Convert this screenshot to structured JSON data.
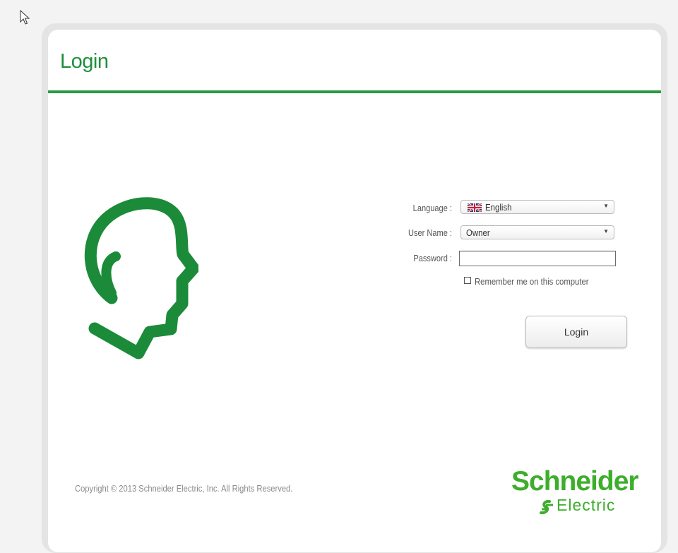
{
  "page": {
    "title": "Login"
  },
  "form": {
    "language_label": "Language :",
    "language_value": "English",
    "username_label": "User Name :",
    "username_value": "Owner",
    "password_label": "Password :",
    "password_value": "",
    "remember_label": "Remember me on this computer",
    "remember_checked": false,
    "login_button_label": "Login"
  },
  "footer": {
    "copyright": "Copyright © 2013 Schneider Electric, Inc. All Rights Reserved."
  },
  "brand": {
    "wordmark": "Schneider Electric",
    "wordmark_top": "Schneider",
    "wordmark_bottom": "Electric"
  },
  "icons": {
    "cursor": "mouse-pointer-icon",
    "logo": "head-profile-logo-icon",
    "flag": "uk-flag-icon",
    "dropdown": "chevron-down-icon"
  },
  "colors": {
    "accent_green": "#2a9a44",
    "brand_green": "#3dae2b",
    "title_green": "#1f8f3c"
  }
}
